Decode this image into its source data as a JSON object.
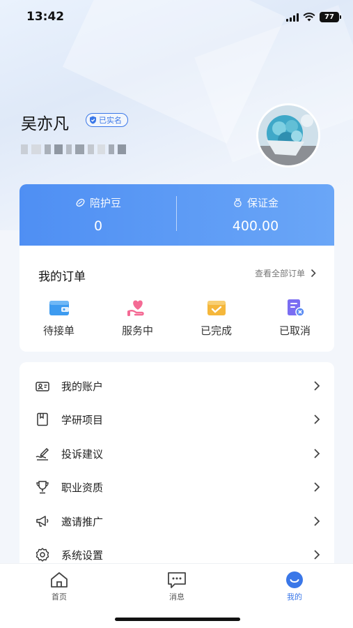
{
  "status_bar": {
    "time": "13:42",
    "battery": "77"
  },
  "profile": {
    "name": "吴亦凡",
    "verified_label": "已实名"
  },
  "wallet": {
    "left": {
      "label": "陪护豆",
      "value": "0"
    },
    "right": {
      "label": "保证金",
      "value": "400.00"
    }
  },
  "orders": {
    "title": "我的订单",
    "view_all": "查看全部订单",
    "items": [
      {
        "label": "待接单",
        "icon": "wallet-icon"
      },
      {
        "label": "服务中",
        "icon": "heart-hand-icon"
      },
      {
        "label": "已完成",
        "icon": "box-check-icon"
      },
      {
        "label": "已取消",
        "icon": "doc-cancel-icon"
      }
    ]
  },
  "menu": {
    "items": [
      {
        "label": "我的账户",
        "icon": "account-icon"
      },
      {
        "label": "学研项目",
        "icon": "bookmark-icon"
      },
      {
        "label": "投诉建议",
        "icon": "pen-icon"
      },
      {
        "label": "职业资质",
        "icon": "trophy-icon"
      },
      {
        "label": "邀请推广",
        "icon": "megaphone-icon"
      },
      {
        "label": "系统设置",
        "icon": "gear-icon"
      }
    ]
  },
  "tabbar": {
    "tabs": [
      {
        "label": "首页",
        "icon": "home-icon"
      },
      {
        "label": "消息",
        "icon": "message-icon"
      },
      {
        "label": "我的",
        "icon": "profile-icon"
      }
    ],
    "active": "我的"
  },
  "colors": {
    "accent": "#3a77e8",
    "wallet_start": "#4f8ff3",
    "wallet_end": "#6aa6f7"
  }
}
